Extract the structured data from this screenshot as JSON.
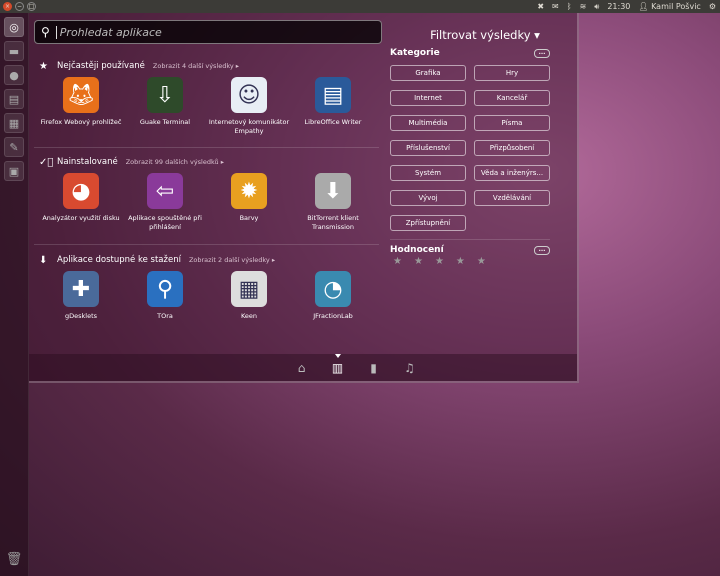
{
  "panel": {
    "time": "21:30",
    "user": "Kamil Pošvic",
    "window_buttons": [
      "close",
      "minimize",
      "maximize"
    ]
  },
  "launcher": {
    "items": [
      "dash-home",
      "files",
      "firefox",
      "libreoffice-writer",
      "app",
      "settings",
      "workspace-switcher"
    ]
  },
  "search": {
    "placeholder": "Prohledat aplikace",
    "value": ""
  },
  "sections": [
    {
      "title": "Nejčastěji používané",
      "more": "Zobrazit 4 další výsledky",
      "icon": "star-icon",
      "apps": [
        {
          "label": "Firefox Webový prohlížeč",
          "icon": "firefox-icon",
          "color": "#e8701a"
        },
        {
          "label": "Guake Terminal",
          "icon": "terminal-icon",
          "color": "#2e4a2a"
        },
        {
          "label": "Internetový komunikátor Empathy",
          "icon": "chat-icon",
          "color": "#e8eef5"
        },
        {
          "label": "LibreOffice Writer",
          "icon": "writer-icon",
          "color": "#2a5a9a"
        }
      ]
    },
    {
      "title": "Nainstalované",
      "more": "Zobrazit 99 dalších výsledků",
      "icon": "check-icon",
      "apps": [
        {
          "label": "Analyzátor využití disku",
          "icon": "pie-chart-icon",
          "color": "#d84a30"
        },
        {
          "label": "Aplikace spouštěné při přihlášení",
          "icon": "startup-icon",
          "color": "#8a3a9a"
        },
        {
          "label": "Barvy",
          "icon": "color-flower-icon",
          "color": "#e8a020"
        },
        {
          "label": "BitTorrent klient Transmission",
          "icon": "transmission-icon",
          "color": "#aaaaaa"
        }
      ]
    },
    {
      "title": "Aplikace dostupné ke stažení",
      "more": "Zobrazit 2 další výsledky",
      "icon": "download-icon",
      "apps": [
        {
          "label": "gDesklets",
          "icon": "puzzle-icon",
          "color": "#4a6a9a"
        },
        {
          "label": "TOra",
          "icon": "magnifier-icon",
          "color": "#2a70c0"
        },
        {
          "label": "Keen",
          "icon": "keen-grid-icon",
          "color": "#dddddd"
        },
        {
          "label": "JFractionLab",
          "icon": "fraction-pie-icon",
          "color": "#3a8ab0"
        }
      ]
    }
  ],
  "filters": {
    "title": "Filtrovat výsledky",
    "categories_title": "Kategorie",
    "more": "...",
    "categories": [
      "Grafika",
      "Hry",
      "Internet",
      "Kancelář",
      "Multimédia",
      "Písma",
      "Příslušenství",
      "Přizpůsobení",
      "Systém",
      "Věda a inženýrs...",
      "Vývoj",
      "Vzdělávání",
      "Zpřístupnění"
    ],
    "rating_title": "Hodnocení",
    "rating": 0,
    "rating_max": 5
  },
  "lenses": [
    {
      "name": "home",
      "active": false
    },
    {
      "name": "applications",
      "active": true
    },
    {
      "name": "files",
      "active": false
    },
    {
      "name": "music",
      "active": false
    }
  ]
}
